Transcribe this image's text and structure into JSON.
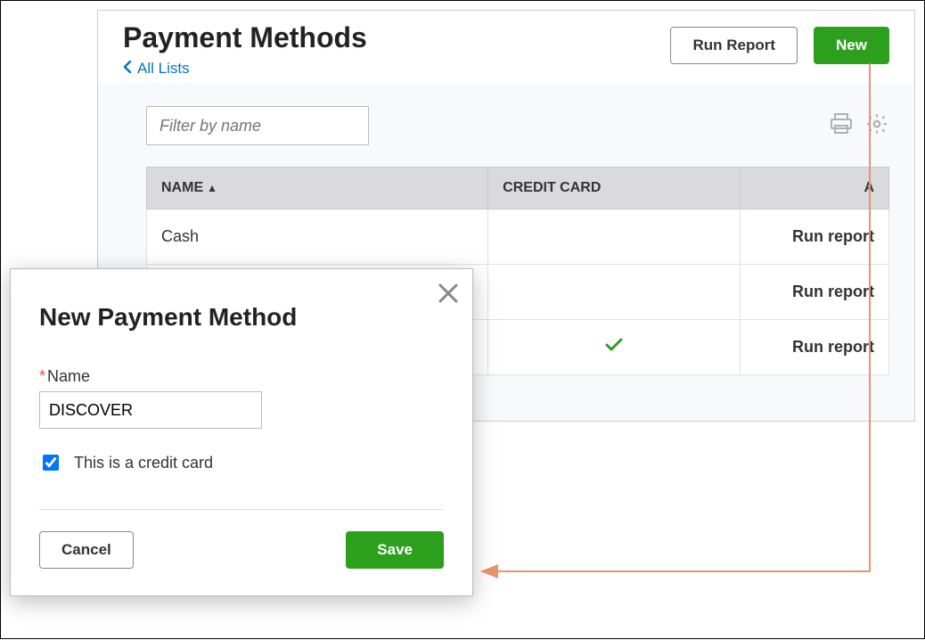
{
  "header": {
    "title": "Payment Methods",
    "breadcrumb_label": "All Lists",
    "run_report_label": "Run Report",
    "new_label": "New"
  },
  "filter": {
    "placeholder": "Filter by name"
  },
  "columns": {
    "name": "NAME",
    "credit_card": "CREDIT CARD",
    "action": "A"
  },
  "rows": [
    {
      "name": "Cash",
      "credit_card": false,
      "action": "Run report"
    },
    {
      "name": "",
      "credit_card": false,
      "action": "Run report"
    },
    {
      "name": "",
      "credit_card": true,
      "action": "Run report"
    }
  ],
  "dialog": {
    "title": "New Payment Method",
    "name_label": "Name",
    "name_value": "DISCOVER",
    "credit_card_label": "This is a credit card",
    "credit_card_checked": true,
    "cancel_label": "Cancel",
    "save_label": "Save"
  }
}
